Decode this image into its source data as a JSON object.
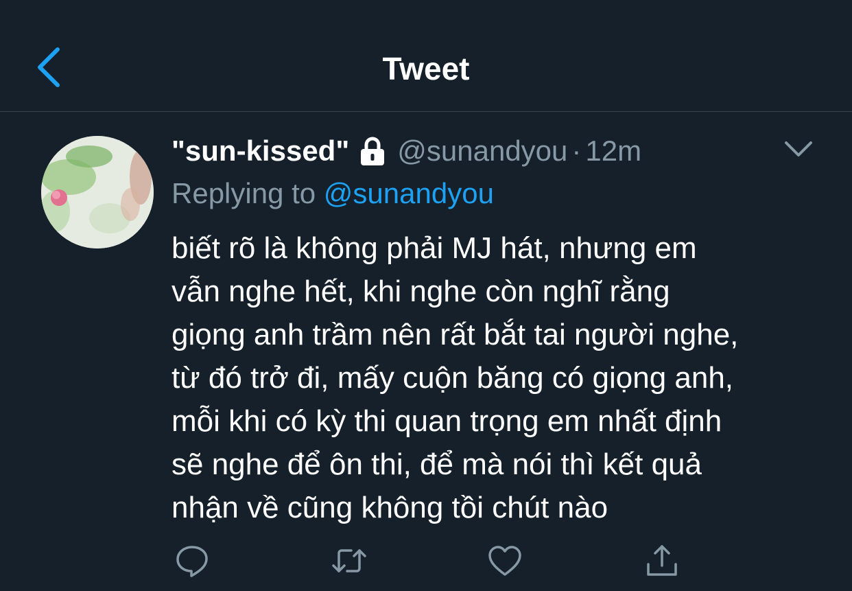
{
  "header": {
    "title": "Tweet"
  },
  "tweet": {
    "display_name": "\"sun-kissed\"",
    "handle": "@sunandyou",
    "separator": "·",
    "time": "12m",
    "replying_label": "Replying to",
    "replying_to": "@sunandyou",
    "body_lines": [
      "biết rõ là không phải MJ hát, nhưng em",
      "vẫn nghe hết, khi nghe còn nghĩ rằng",
      "giọng anh trầm nên rất bắt tai người nghe,",
      "từ đó trở đi, mấy cuộn băng có giọng anh,",
      "mỗi khi có kỳ thi quan trọng em nhất định",
      "sẽ nghe để ôn thi, để mà nói thì kết quả",
      "nhận về cũng không tồi chút nào"
    ]
  },
  "icons": {
    "back": "chevron-left-icon",
    "lock": "lock-icon",
    "more": "chevron-down-icon",
    "reply": "reply-icon",
    "retweet": "retweet-icon",
    "like": "heart-icon",
    "share": "share-icon"
  },
  "colors": {
    "background": "#15202b",
    "accent": "#1da1f2",
    "secondary_text": "#8899a6",
    "divider": "#38444d"
  }
}
